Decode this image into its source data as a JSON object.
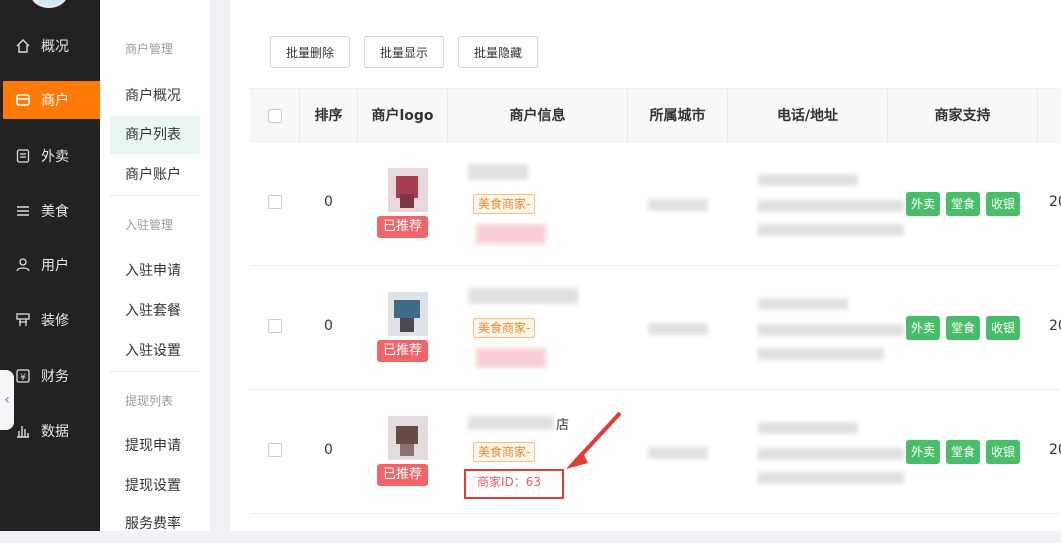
{
  "rail": {
    "items": [
      {
        "label": "概况",
        "icon": "home-icon"
      },
      {
        "label": "商户",
        "icon": "store-icon",
        "active": true
      },
      {
        "label": "外卖",
        "icon": "document-icon"
      },
      {
        "label": "美食",
        "icon": "menu-lines-icon"
      },
      {
        "label": "用户",
        "icon": "user-icon"
      },
      {
        "label": "装修",
        "icon": "decorate-icon"
      },
      {
        "label": "财务",
        "icon": "finance-icon"
      },
      {
        "label": "数据",
        "icon": "bar-chart-icon"
      }
    ],
    "collapse_glyph": "‹"
  },
  "submenu": {
    "group1": {
      "title": "商户管理",
      "items": [
        "商户概况",
        "商户列表",
        "商户账户"
      ]
    },
    "group2": {
      "title": "入驻管理",
      "items": [
        "入驻申请",
        "入驻套餐",
        "入驻设置"
      ]
    },
    "group3": {
      "title": "提现列表",
      "items": [
        "提现申请",
        "提现设置",
        "服务费率"
      ]
    }
  },
  "toolbar": {
    "batch_delete": "批量删除",
    "batch_show": "批量显示",
    "batch_hide": "批量隐藏"
  },
  "table": {
    "headers": [
      "排序",
      "商户logo",
      "商户信息",
      "所属城市",
      "电话/地址",
      "商家支持"
    ],
    "rows": [
      {
        "sort": "0",
        "recommend": "已推荐",
        "merchant_type": "美食商家-",
        "name_suffix": "",
        "merchant_id": "",
        "services": [
          "外卖",
          "堂食",
          "收银"
        ],
        "overflow": "20"
      },
      {
        "sort": "0",
        "recommend": "已推荐",
        "merchant_type": "美食商家-",
        "name_suffix": "",
        "merchant_id": "",
        "services": [
          "外卖",
          "堂食",
          "收银"
        ],
        "overflow": "20"
      },
      {
        "sort": "0",
        "recommend": "已推荐",
        "merchant_type": "美食商家-",
        "name_suffix": "店",
        "merchant_id": "商家ID：63",
        "services": [
          "外卖",
          "堂食",
          "收银"
        ],
        "overflow": "20"
      }
    ]
  },
  "colors": {
    "rail_bg": "#222222",
    "accent": "#ff7a06",
    "recommend_badge": "#f0656a",
    "service_tag": "#49be6a",
    "highlight": "#e83a35"
  }
}
